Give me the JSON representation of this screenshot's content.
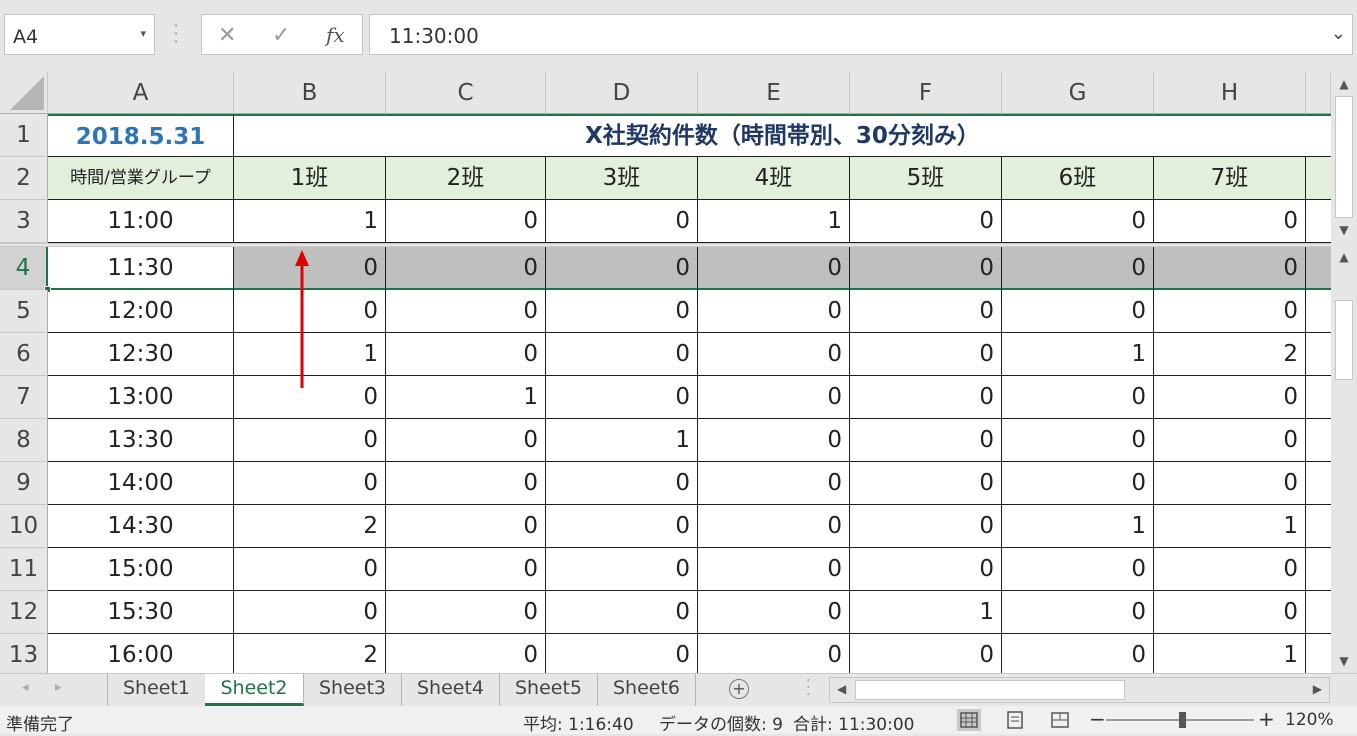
{
  "formula_bar": {
    "name_box": "A4",
    "formula": "11:30:00",
    "cancel_glyph": "✕",
    "enter_glyph": "✓",
    "fx_glyph": "fx"
  },
  "columns": [
    "A",
    "B",
    "C",
    "D",
    "E",
    "F",
    "G",
    "H"
  ],
  "rows": [
    "1",
    "2",
    "3",
    "4",
    "5",
    "6",
    "7",
    "8",
    "9",
    "10",
    "11",
    "12",
    "13"
  ],
  "sheet": {
    "date": "2018.5.31",
    "title": "X社契約件数（時間帯別、30分刻み）",
    "row_label": "時間/営業グループ",
    "groups": [
      "1班",
      "2班",
      "3班",
      "4班",
      "5班",
      "6班",
      "7班"
    ],
    "data": [
      {
        "time": "11:00",
        "values": [
          "1",
          "0",
          "0",
          "1",
          "0",
          "0",
          "0"
        ]
      },
      {
        "time": "11:30",
        "values": [
          "0",
          "0",
          "0",
          "0",
          "0",
          "0",
          "0"
        ]
      },
      {
        "time": "12:00",
        "values": [
          "0",
          "0",
          "0",
          "0",
          "0",
          "0",
          "0"
        ]
      },
      {
        "time": "12:30",
        "values": [
          "1",
          "0",
          "0",
          "0",
          "0",
          "1",
          "2"
        ]
      },
      {
        "time": "13:00",
        "values": [
          "0",
          "1",
          "0",
          "0",
          "0",
          "0",
          "0"
        ]
      },
      {
        "time": "13:30",
        "values": [
          "0",
          "0",
          "1",
          "0",
          "0",
          "0",
          "0"
        ]
      },
      {
        "time": "14:00",
        "values": [
          "0",
          "0",
          "0",
          "0",
          "0",
          "0",
          "0"
        ]
      },
      {
        "time": "14:30",
        "values": [
          "2",
          "0",
          "0",
          "0",
          "0",
          "1",
          "1"
        ]
      },
      {
        "time": "15:00",
        "values": [
          "0",
          "0",
          "0",
          "0",
          "0",
          "0",
          "0"
        ]
      },
      {
        "time": "15:30",
        "values": [
          "0",
          "0",
          "0",
          "0",
          "1",
          "0",
          "0"
        ]
      },
      {
        "time": "16:00",
        "values": [
          "2",
          "0",
          "0",
          "0",
          "0",
          "0",
          "1"
        ]
      }
    ]
  },
  "tabs": [
    "Sheet1",
    "Sheet2",
    "Sheet3",
    "Sheet4",
    "Sheet5",
    "Sheet6"
  ],
  "active_tab": "Sheet2",
  "status": {
    "ready": "準備完了",
    "average": "平均: 1:16:40",
    "count": "データの個数: 9",
    "sum": "合計: 11:30:00",
    "zoom": "120%"
  },
  "colors": {
    "accent": "#217346",
    "date": "#2e75b6",
    "title": "#1f3864",
    "header_band": "#e2efda",
    "selection": "#bfbfbf",
    "arrow": "#e00000"
  }
}
